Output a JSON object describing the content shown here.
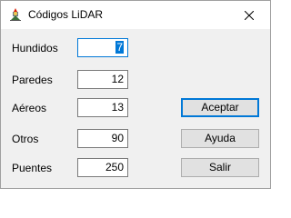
{
  "window": {
    "title": "Códigos LiDAR",
    "icon": "app-icon",
    "close_icon": "close-icon"
  },
  "fields": [
    {
      "label": "Hundidos",
      "value": "7",
      "focused": true
    },
    {
      "label": "Paredes",
      "value": "12"
    },
    {
      "label": "Aéreos",
      "value": "13"
    },
    {
      "label": "Otros",
      "value": "90"
    },
    {
      "label": "Puentes",
      "value": "250"
    }
  ],
  "buttons": {
    "accept_label": "Aceptar",
    "help_label": "Ayuda",
    "exit_label": "Salir"
  },
  "colors": {
    "accent": "#0078d7",
    "window_bg": "#f0f0f0",
    "button_bg": "#e1e1e1"
  }
}
